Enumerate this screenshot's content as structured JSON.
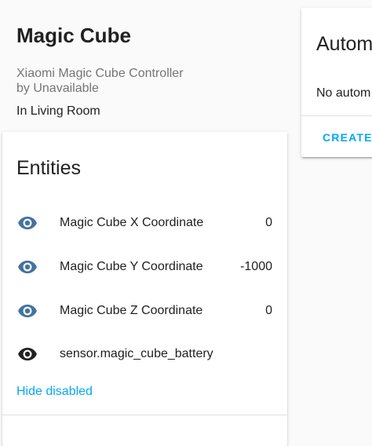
{
  "device": {
    "name": "Magic Cube",
    "model_line": "Xiaomi Magic Cube Controller",
    "manufacturer_line": "by Unavailable",
    "area_line": "In Living Room"
  },
  "entities_card": {
    "title": "Entities",
    "rows": [
      {
        "icon": "eye-icon",
        "name": "Magic Cube X Coordinate",
        "value": "0",
        "icon_color": "#44739e"
      },
      {
        "icon": "eye-icon",
        "name": "Magic Cube Y Coordinate",
        "value": "-1000",
        "icon_color": "#44739e"
      },
      {
        "icon": "eye-icon",
        "name": "Magic Cube Z Coordinate",
        "value": "0",
        "icon_color": "#44739e"
      },
      {
        "icon": "eye-icon",
        "name": "sensor.magic_cube_battery",
        "value": "",
        "icon_color": "#212121"
      }
    ],
    "hide_disabled_label": "Hide disabled"
  },
  "automation_card": {
    "title": "Autom",
    "empty_text": "No autom",
    "create_label": "CREATE"
  },
  "colors": {
    "accent": "#03a9f4",
    "state_icon": "#44739e"
  }
}
